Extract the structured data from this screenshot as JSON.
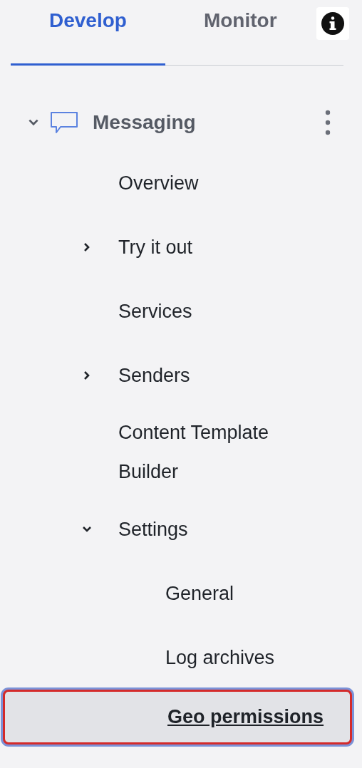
{
  "tabs": [
    {
      "label": "Develop",
      "selected": true
    },
    {
      "label": "Monitor",
      "selected": false
    }
  ],
  "product": {
    "name": "Messaging",
    "expanded": true
  },
  "items": [
    {
      "label": "Overview",
      "selected": false
    },
    {
      "label": "Try it out",
      "kind": "group",
      "expanded": false,
      "selected": false
    },
    {
      "label": "Services",
      "selected": false
    },
    {
      "label": "Senders",
      "kind": "group",
      "expanded": false,
      "selected": false
    },
    {
      "label": "Content Template Builder",
      "selected": false
    },
    {
      "label": "Settings",
      "kind": "group",
      "expanded": true,
      "selected": false,
      "children": [
        {
          "label": "General",
          "selected": false
        },
        {
          "label": "Log archives",
          "selected": false
        },
        {
          "label": "Geo permissions",
          "selected": true
        }
      ]
    }
  ]
}
